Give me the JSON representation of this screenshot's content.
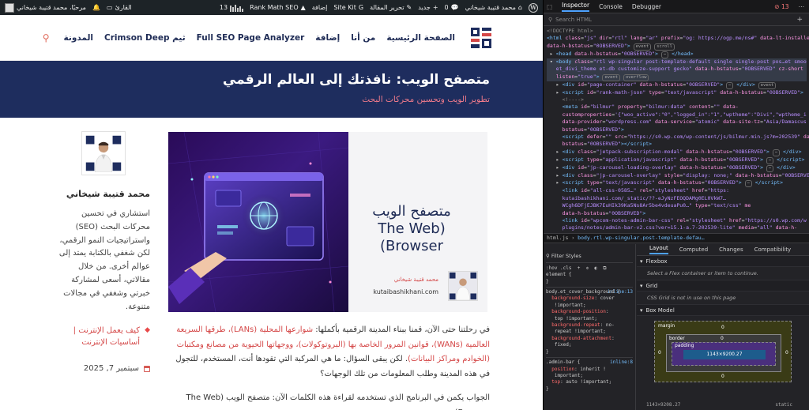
{
  "adminbar": {
    "greeting": "مرحبًا، محمد قتيبة شيخاني",
    "reader": "القارئ",
    "stats_count": "13",
    "rankmath": "Rank Math SEO",
    "add_wp": "إضافة",
    "sitekit": "Site Kit",
    "edit_post": "تحرير المقالة",
    "new": "جديد",
    "comments_count": "0",
    "site_name": "محمد قتيبة شيخاني"
  },
  "nav": {
    "items": [
      "الصفحة الرئيسية",
      "من أنا",
      "إضافة",
      "Full SEO Page Analyzer",
      "ثيم Crimson Deep",
      "المدونة"
    ]
  },
  "hero": {
    "title": "متصفح الويب: نافذتك إلى العالم الرقمي",
    "subtitle": "تطوير الويب وتحسين محركات البحث"
  },
  "sidebar": {
    "author_name": "محمد قتيبة شيخاني",
    "author_bio": "استشاري في تحسين محركات البحث (SEO) واستراتيجيات النمو الرقمي، لكن شغفي بالكتابة يمتد إلى عوالم أخرى. من خلال مقالاتي، أسعى لمشاركة خبرتي وشغفي في مجالات متنوعة.",
    "categories": "كيف يعمل الإنترنت | أساسيات الإنترنت",
    "date": "سبتمبر 7, 2025"
  },
  "featured": {
    "title_ar": "متصفح الويب",
    "title_en": "(The Web Browser)",
    "author": "محمد قتيبة شيخاني",
    "site": "kutaibashikhani.com"
  },
  "article": {
    "p1_a": "في رحلتنا حتى الآن، قمنا ببناء المدينة الرقمية بأكملها: ",
    "p1_link": "شوارعها المحلية (LANs)، طرقها السريعة العالمية (WANs)، قوانين المرور الخاصة بها (البروتوكولات)، ووجهاتها الحيوية من مصانع ومكتبات (الخوادم ومراكز البيانات)",
    "p1_b": ". لكن يبقى السؤال: ما هي المركبة التي تقودها أنت، المستخدم، للتجول في هذه المدينة وطلب المعلومات من تلك الوجهات؟",
    "p2": "الجواب يكمن في البرنامج الذي تستخدمه لقراءة هذه الكلمات الآن: متصفح الويب (The Web Browser)."
  },
  "devtools": {
    "tabs": [
      "Inspector",
      "Console",
      "Debugger"
    ],
    "error_count": "13",
    "search_placeholder": "Search HTML",
    "breadcrumb_a": "html.js",
    "breadcrumb_b": "body.rtl.wp-singular.post-template-defau…",
    "filter_placeholder": "Filter Styles",
    "layout_tabs": [
      "Layout",
      "Computed",
      "Changes",
      "Compatibility"
    ],
    "flexbox_title": "Flexbox",
    "flexbox_msg": "Select a Flex container or item to continue.",
    "grid_title": "Grid",
    "grid_msg": "CSS Grid is not in use on this page",
    "boxmodel_title": "Box Model",
    "box": {
      "margin_label": "margin",
      "border_label": "border",
      "padding_label": "padding",
      "content": "1143×9200.27",
      "zero": "0"
    },
    "dims": "1143×9208.27",
    "position": "static"
  },
  "colors": {
    "navy": "#1e2d5e",
    "accent": "#d44747",
    "adminbar": "#1d2327",
    "devtools_bg": "#232327"
  }
}
